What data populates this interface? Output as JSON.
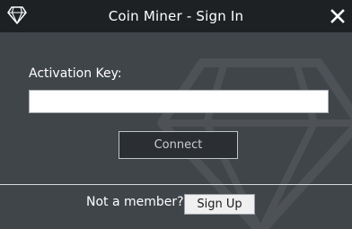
{
  "window": {
    "title": "Coin Miner - Sign In",
    "app_icon": "diamond-icon",
    "close_icon": "close-icon"
  },
  "form": {
    "activation_label": "Activation Key:",
    "activation_value": "",
    "activation_placeholder": "",
    "connect_label": "Connect"
  },
  "footer": {
    "prompt": "Not a member?",
    "signup_label": "Sign Up"
  },
  "colors": {
    "titlebar": "#1e2124",
    "body": "#40454a",
    "connect_button": "#2b2f33",
    "divider": "#d4d8dc"
  }
}
